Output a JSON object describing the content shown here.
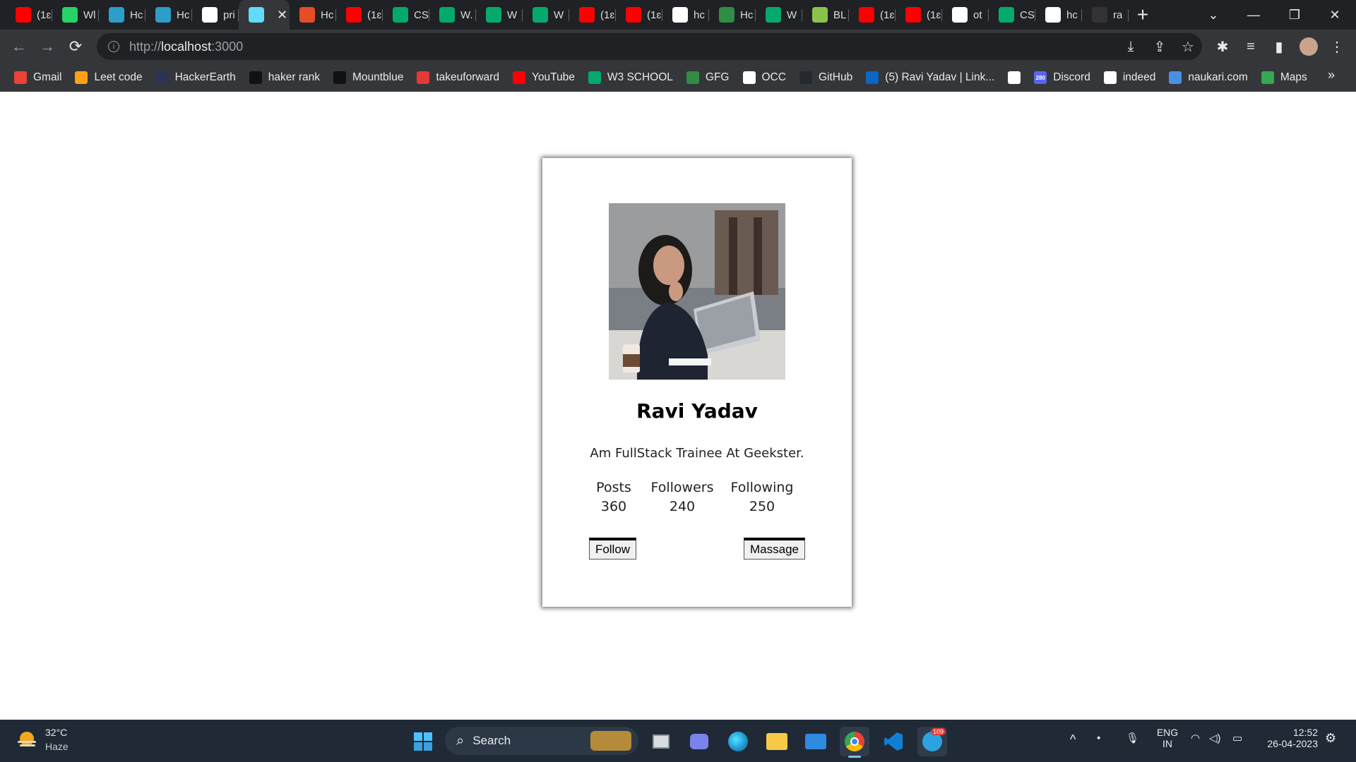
{
  "tabs": [
    {
      "title": "(1ɛ",
      "icon": "youtube-icon",
      "color": "#ff0000"
    },
    {
      "title": "Wl",
      "icon": "whatsapp-icon",
      "color": "#25d366"
    },
    {
      "title": "Hc",
      "icon": "hackerearth-icon",
      "color": "#2c9ec9"
    },
    {
      "title": "Hc",
      "icon": "hackerearth-icon",
      "color": "#2c9ec9"
    },
    {
      "title": "pri",
      "icon": "google-icon",
      "color": "#ffffff"
    },
    {
      "title": "",
      "icon": "react-icon",
      "color": "#61dafb",
      "active": true
    },
    {
      "title": "Hc",
      "icon": "html5-icon",
      "color": "#e44d26"
    },
    {
      "title": "(1ɛ",
      "icon": "youtube-icon",
      "color": "#ff0000"
    },
    {
      "title": "CS",
      "icon": "w3schools-icon",
      "color": "#04aa6d"
    },
    {
      "title": "W.",
      "icon": "w3schools-icon",
      "color": "#04aa6d"
    },
    {
      "title": "W",
      "icon": "w3schools-icon",
      "color": "#04aa6d"
    },
    {
      "title": "W",
      "icon": "w3schools-icon",
      "color": "#04aa6d"
    },
    {
      "title": "(1ɛ",
      "icon": "youtube-icon",
      "color": "#ff0000"
    },
    {
      "title": "(1ɛ",
      "icon": "youtube-icon",
      "color": "#ff0000"
    },
    {
      "title": "hc",
      "icon": "google-icon",
      "color": "#ffffff"
    },
    {
      "title": "Hc",
      "icon": "gfg-icon",
      "color": "#2f8d46"
    },
    {
      "title": "W",
      "icon": "w3schools-icon",
      "color": "#04aa6d"
    },
    {
      "title": "BL",
      "icon": "leaf-icon",
      "color": "#8bc34a"
    },
    {
      "title": "(1ɛ",
      "icon": "youtube-icon",
      "color": "#ff0000"
    },
    {
      "title": "(1ɛ",
      "icon": "youtube-icon",
      "color": "#ff0000"
    },
    {
      "title": "ot",
      "icon": "tab-icon",
      "color": "#ffffff"
    },
    {
      "title": "CS",
      "icon": "w3schools-icon",
      "color": "#04aa6d"
    },
    {
      "title": "hc",
      "icon": "google-icon",
      "color": "#ffffff"
    },
    {
      "title": "ra",
      "icon": "github-icon",
      "color": "#333333"
    }
  ],
  "omnibox": {
    "prefix": "http://",
    "host": "localhost",
    "port": ":3000"
  },
  "bookmarks": [
    {
      "label": "Gmail",
      "icon": "gmail-icon",
      "color": "#ea4335"
    },
    {
      "label": "Leet code",
      "icon": "leetcode-icon",
      "color": "#ffa116"
    },
    {
      "label": "HackerEarth",
      "icon": "hackerearth-icon",
      "color": "#2c3454"
    },
    {
      "label": "haker rank",
      "icon": "hackerrank-icon",
      "color": "#111111"
    },
    {
      "label": "Mountblue",
      "icon": "mountblue-icon",
      "color": "#111111"
    },
    {
      "label": "takeuforward",
      "icon": "takeuforward-icon",
      "color": "#e53935"
    },
    {
      "label": "YouTube",
      "icon": "youtube-icon",
      "color": "#ff0000"
    },
    {
      "label": "W3 SCHOOL",
      "icon": "w3schools-icon",
      "color": "#04aa6d"
    },
    {
      "label": "GFG",
      "icon": "gfg-icon",
      "color": "#2f8d46"
    },
    {
      "label": "OCC",
      "icon": "occ-icon",
      "color": "#ffffff"
    },
    {
      "label": "GitHub",
      "icon": "github-icon",
      "color": "#24292e"
    },
    {
      "label": "(5) Ravi Yadav | Link...",
      "icon": "linkedin-icon",
      "color": "#0a66c2"
    },
    {
      "label": "",
      "icon": "globe-icon",
      "color": "#ffffff"
    },
    {
      "label": "Discord",
      "icon": "discord-icon",
      "color": "#5865f2"
    },
    {
      "label": "indeed",
      "icon": "info-icon",
      "color": "#ffffff"
    },
    {
      "label": "naukari.com",
      "icon": "naukri-icon",
      "color": "#4a90e2"
    },
    {
      "label": "Maps",
      "icon": "maps-icon",
      "color": "#34a853"
    }
  ],
  "bookmarks_overflow": "»",
  "badges": {
    "discord": "280",
    "telegram": "109"
  },
  "profile": {
    "name": "Ravi Yadav",
    "bio": "Am FullStack Trainee At Geekster.",
    "stats": [
      {
        "label": "Posts",
        "value": "360"
      },
      {
        "label": "Followers",
        "value": "240"
      },
      {
        "label": "Following",
        "value": "250"
      }
    ],
    "follow_label": "Follow",
    "message_label": "Massage"
  },
  "taskbar": {
    "weather_temp": "32°C",
    "weather_desc": "Haze",
    "search_label": "Search",
    "lang_line1": "ENG",
    "lang_line2": "IN",
    "time": "12:52",
    "date": "26-04-2023"
  }
}
